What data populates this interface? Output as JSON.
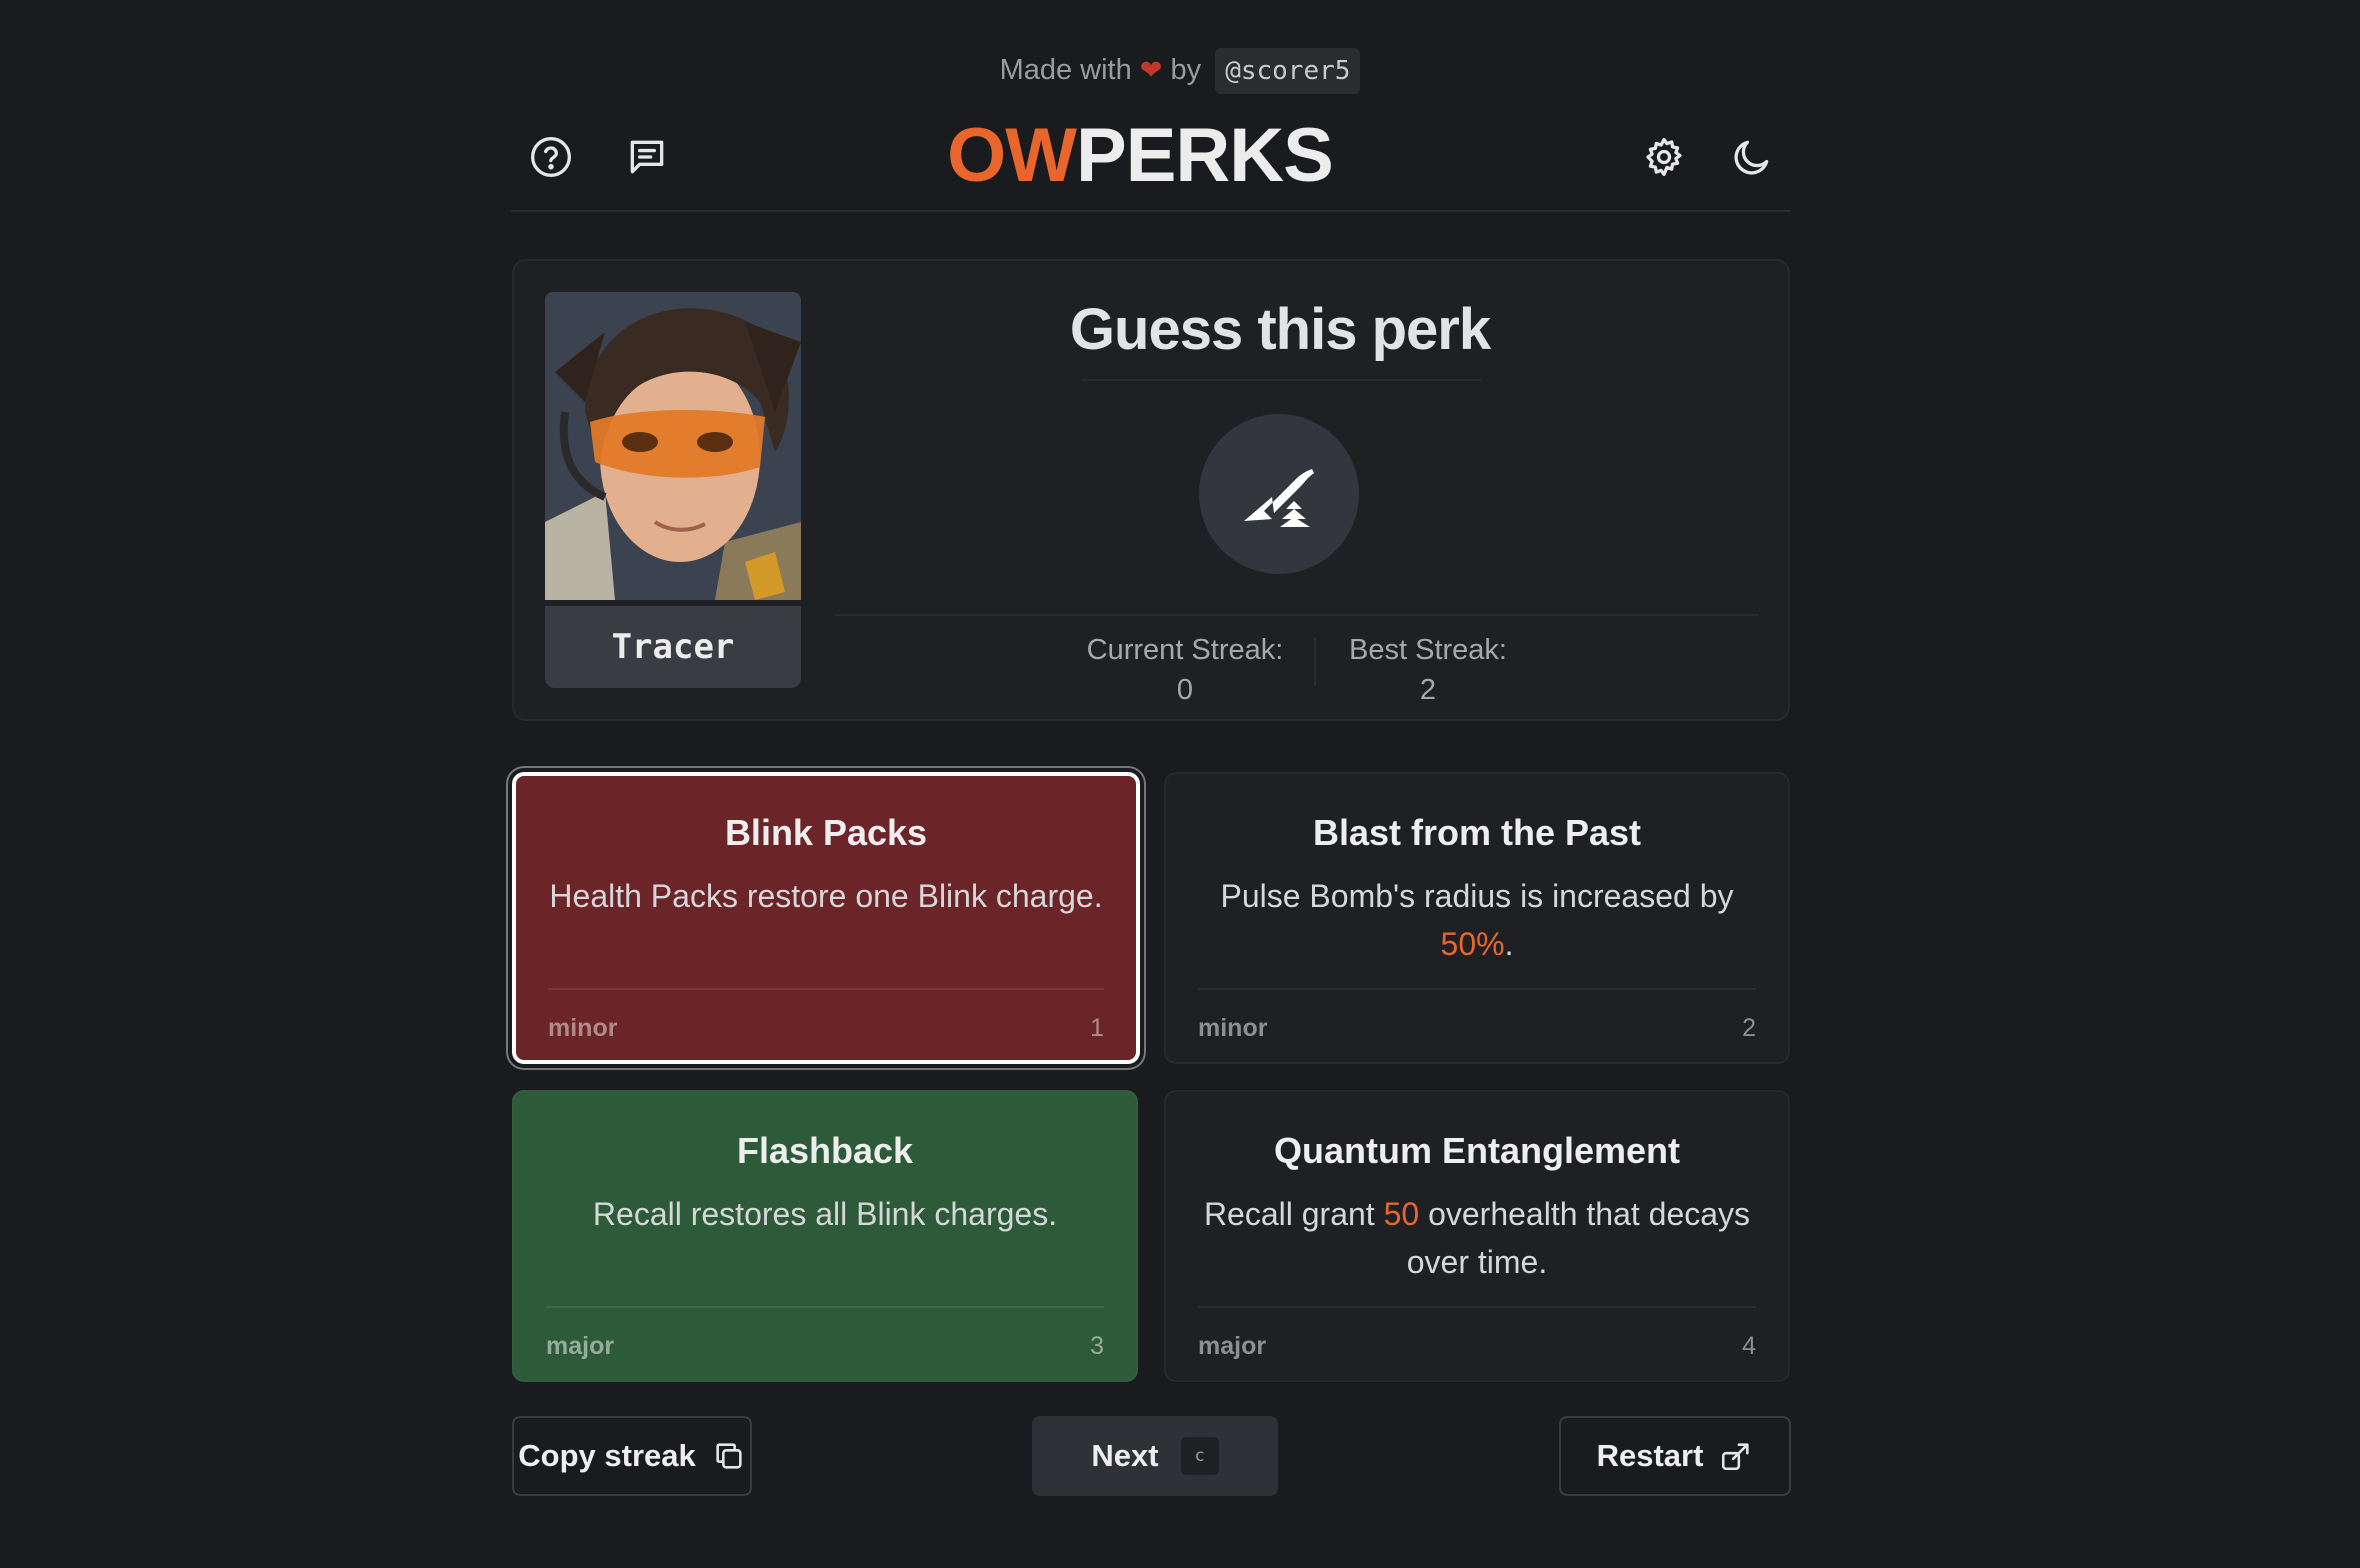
{
  "credit": {
    "prefix": "Made with",
    "heart": "❤",
    "by": "by",
    "handle": "@scorer5"
  },
  "header": {
    "logo_accent": "OW",
    "logo_main": "PERKS"
  },
  "hero": {
    "character_name": "Tracer",
    "title": "Guess this perk",
    "current_streak_label": "Current Streak:",
    "current_streak_value": "0",
    "best_streak_label": "Best Streak:",
    "best_streak_value": "2"
  },
  "options": [
    {
      "title": "Blink Packs",
      "desc": "Health Packs restore one Blink charge.",
      "type": "minor",
      "number": "1",
      "state": "wrong-selected"
    },
    {
      "title": "Blast from the Past",
      "desc_pre": "Pulse Bomb's radius is increased by ",
      "desc_hl": "50%",
      "desc_post": ".",
      "type": "minor",
      "number": "2",
      "state": "neutral"
    },
    {
      "title": "Flashback",
      "desc": "Recall restores all Blink charges.",
      "type": "major",
      "number": "3",
      "state": "correct"
    },
    {
      "title": "Quantum Entanglement",
      "desc_pre": "Recall grant ",
      "desc_hl": "50",
      "desc_post": " overhealth that decays over time.",
      "type": "major",
      "number": "4",
      "state": "neutral"
    }
  ],
  "buttons": {
    "copy": "Copy streak",
    "next": "Next",
    "next_key": "c",
    "restart": "Restart"
  },
  "colors": {
    "accent": "#e8652b",
    "wrong": "#6b2528",
    "correct": "#2d5b3a",
    "background": "#1a1b1e",
    "card": "#1f2024"
  },
  "icons": [
    "help-icon",
    "feedback-icon",
    "settings-icon",
    "dark-mode-icon",
    "perk-icon",
    "copy-icon",
    "share-icon"
  ]
}
